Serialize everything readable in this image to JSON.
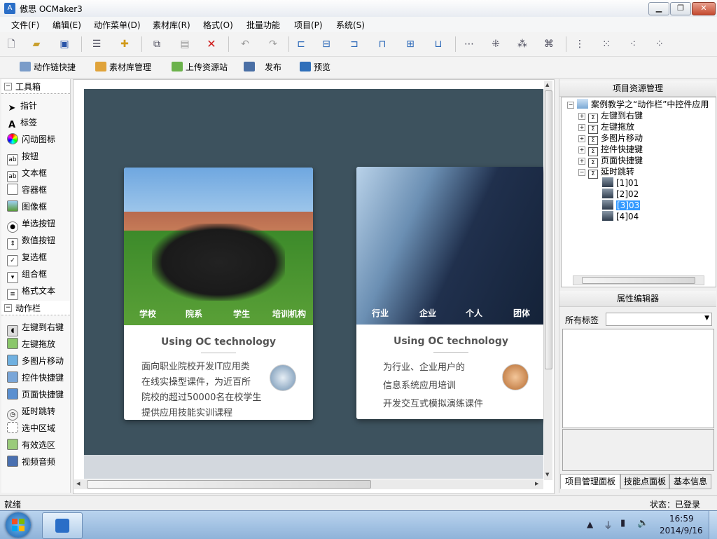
{
  "window": {
    "title": "傲思 OCMaker3",
    "app_icon_glyph": "A"
  },
  "window_controls": {
    "minimize": "▁",
    "maximize": "❐",
    "close": "✕"
  },
  "menu": [
    "文件(F)",
    "编辑(E)",
    "动作菜单(D)",
    "素材库(R)",
    "格式(O)",
    "批量功能",
    "项目(P)",
    "系统(S)"
  ],
  "toolbar1_icons": [
    "new-file-icon",
    "open-folder-icon",
    "save-icon",
    "properties-icon",
    "puzzle-icon",
    "copy-icon",
    "paste-icon",
    "delete-icon",
    "undo-icon",
    "redo-icon",
    "align-left-icon",
    "align-center-icon",
    "align-right-icon",
    "align-top-icon",
    "align-middle-icon",
    "align-bottom-icon",
    "distribute-horizontal-icon",
    "same-width-icon",
    "same-height-icon",
    "same-size-icon",
    "distribute-vertical-icon",
    "space-horizontal-icon",
    "space-vertical-icon",
    "center-both-icon"
  ],
  "toolbar2": {
    "action_chain": "动作链快捷",
    "asset_manager": "素材库管理",
    "upload": "上传资源站",
    "publish": "发布",
    "preview": "预览"
  },
  "toolbox": {
    "header": "工具箱",
    "items": [
      "指针",
      "标签",
      "闪动图标",
      "按钮",
      "文本框",
      "容器框",
      "图像框",
      "单选按钮",
      "数值按钮",
      "复选框",
      "组合框",
      "格式文本"
    ],
    "action_header": "动作栏",
    "action_items": [
      "左键到右键",
      "左键拖放",
      "多图片移动",
      "控件快捷键",
      "页面快捷键",
      "延时跳转",
      "选中区域",
      "有效选区",
      "视频音频"
    ]
  },
  "card1": {
    "tabs": [
      "学校",
      "院系",
      "学生",
      "培训机构"
    ],
    "title": "Using OC technology",
    "lines": [
      "面向职业院校开发IT应用类",
      "在线实操型课件，为近百所",
      "院校的超过50000名在校学生",
      "提供应用技能实训课程"
    ]
  },
  "card2": {
    "tabs": [
      "行业",
      "企业",
      "个人",
      "团体"
    ],
    "title": "Using OC technology",
    "lines": [
      "为行业、企业用户的",
      "信息系统应用培训",
      "开发交互式模拟演练课件"
    ]
  },
  "project_panel": {
    "title": "项目资源管理",
    "root": "案例教学之“动作栏”中控件应用",
    "children": [
      "左键到右键",
      "左键拖放",
      "多图片移动",
      "控件快捷键",
      "页面快捷键",
      "延时跳转"
    ],
    "subitems": [
      "[1]01",
      "[2]02",
      "[3]03",
      "[4]04"
    ],
    "selected_subitem": "[3]03"
  },
  "property_panel": {
    "title": "属性编辑器",
    "filter_label": "所有标签",
    "filter_value": ""
  },
  "panel_tabs": [
    "项目管理面板",
    "技能点面板",
    "基本信息"
  ],
  "status": {
    "left": "就绪",
    "right": "状态：已登录"
  },
  "taskbar": {
    "time": "16:59",
    "date": "2014/9/16"
  },
  "colors": {
    "canvas_bg": "#3d525e",
    "selection": "#3399ff"
  }
}
